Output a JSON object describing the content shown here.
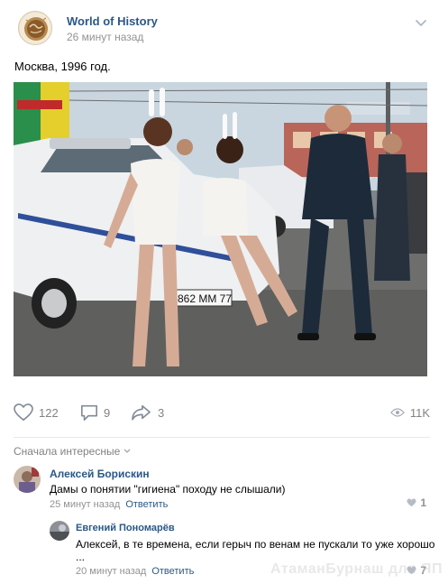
{
  "post": {
    "author": "World of History",
    "time": "26 минут назад",
    "text": "Москва, 1996 год.",
    "photo_plate": "Н 862 ММ 77"
  },
  "actions": {
    "likes": "122",
    "comments": "9",
    "shares": "3",
    "views": "11K"
  },
  "comments_section": {
    "sort_label": "Сначала интересные"
  },
  "comments": [
    {
      "author": "Алексей Борискин",
      "text": "Дамы о понятии \"гигиена\" походу не слышали)",
      "time": "25 минут назад",
      "reply_label": "Ответить",
      "likes": "1"
    },
    {
      "author": "Евгений Пономарёв",
      "text": "Алексей, в те времена, если герыч по венам не пускали то уже хорошо",
      "text_more": "...",
      "time": "20 минут назад",
      "reply_label": "Ответить",
      "likes": "7"
    }
  ],
  "watermark": "АтаманБурнаш для ЯП",
  "colors": {
    "link": "#2a5885",
    "muted": "#828282",
    "divider": "#e7e8ec"
  }
}
